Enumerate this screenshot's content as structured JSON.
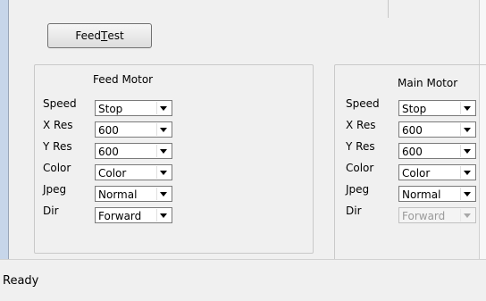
{
  "toolbar": {
    "feed_test_label_pre": "Feed ",
    "feed_test_label_ul": "T",
    "feed_test_label_post": "est"
  },
  "feed_motor": {
    "title": "Feed Motor",
    "rows": [
      {
        "label": "Speed",
        "value": "Stop"
      },
      {
        "label": "X Res",
        "value": "600"
      },
      {
        "label": "Y Res",
        "value": "600"
      },
      {
        "label": "Color",
        "value": "Color"
      },
      {
        "label": "Jpeg",
        "value": "Normal"
      },
      {
        "label": "Dir",
        "value": "Forward"
      }
    ]
  },
  "main_motor": {
    "title": "Main Motor",
    "rows": [
      {
        "label": "Speed",
        "value": "Stop"
      },
      {
        "label": "X Res",
        "value": "600"
      },
      {
        "label": "Y Res",
        "value": "600"
      },
      {
        "label": "Color",
        "value": "Color"
      },
      {
        "label": "Jpeg",
        "value": "Normal"
      },
      {
        "label": "Dir",
        "value": "Forward",
        "disabled": true
      }
    ]
  },
  "status": {
    "text": "Ready"
  }
}
